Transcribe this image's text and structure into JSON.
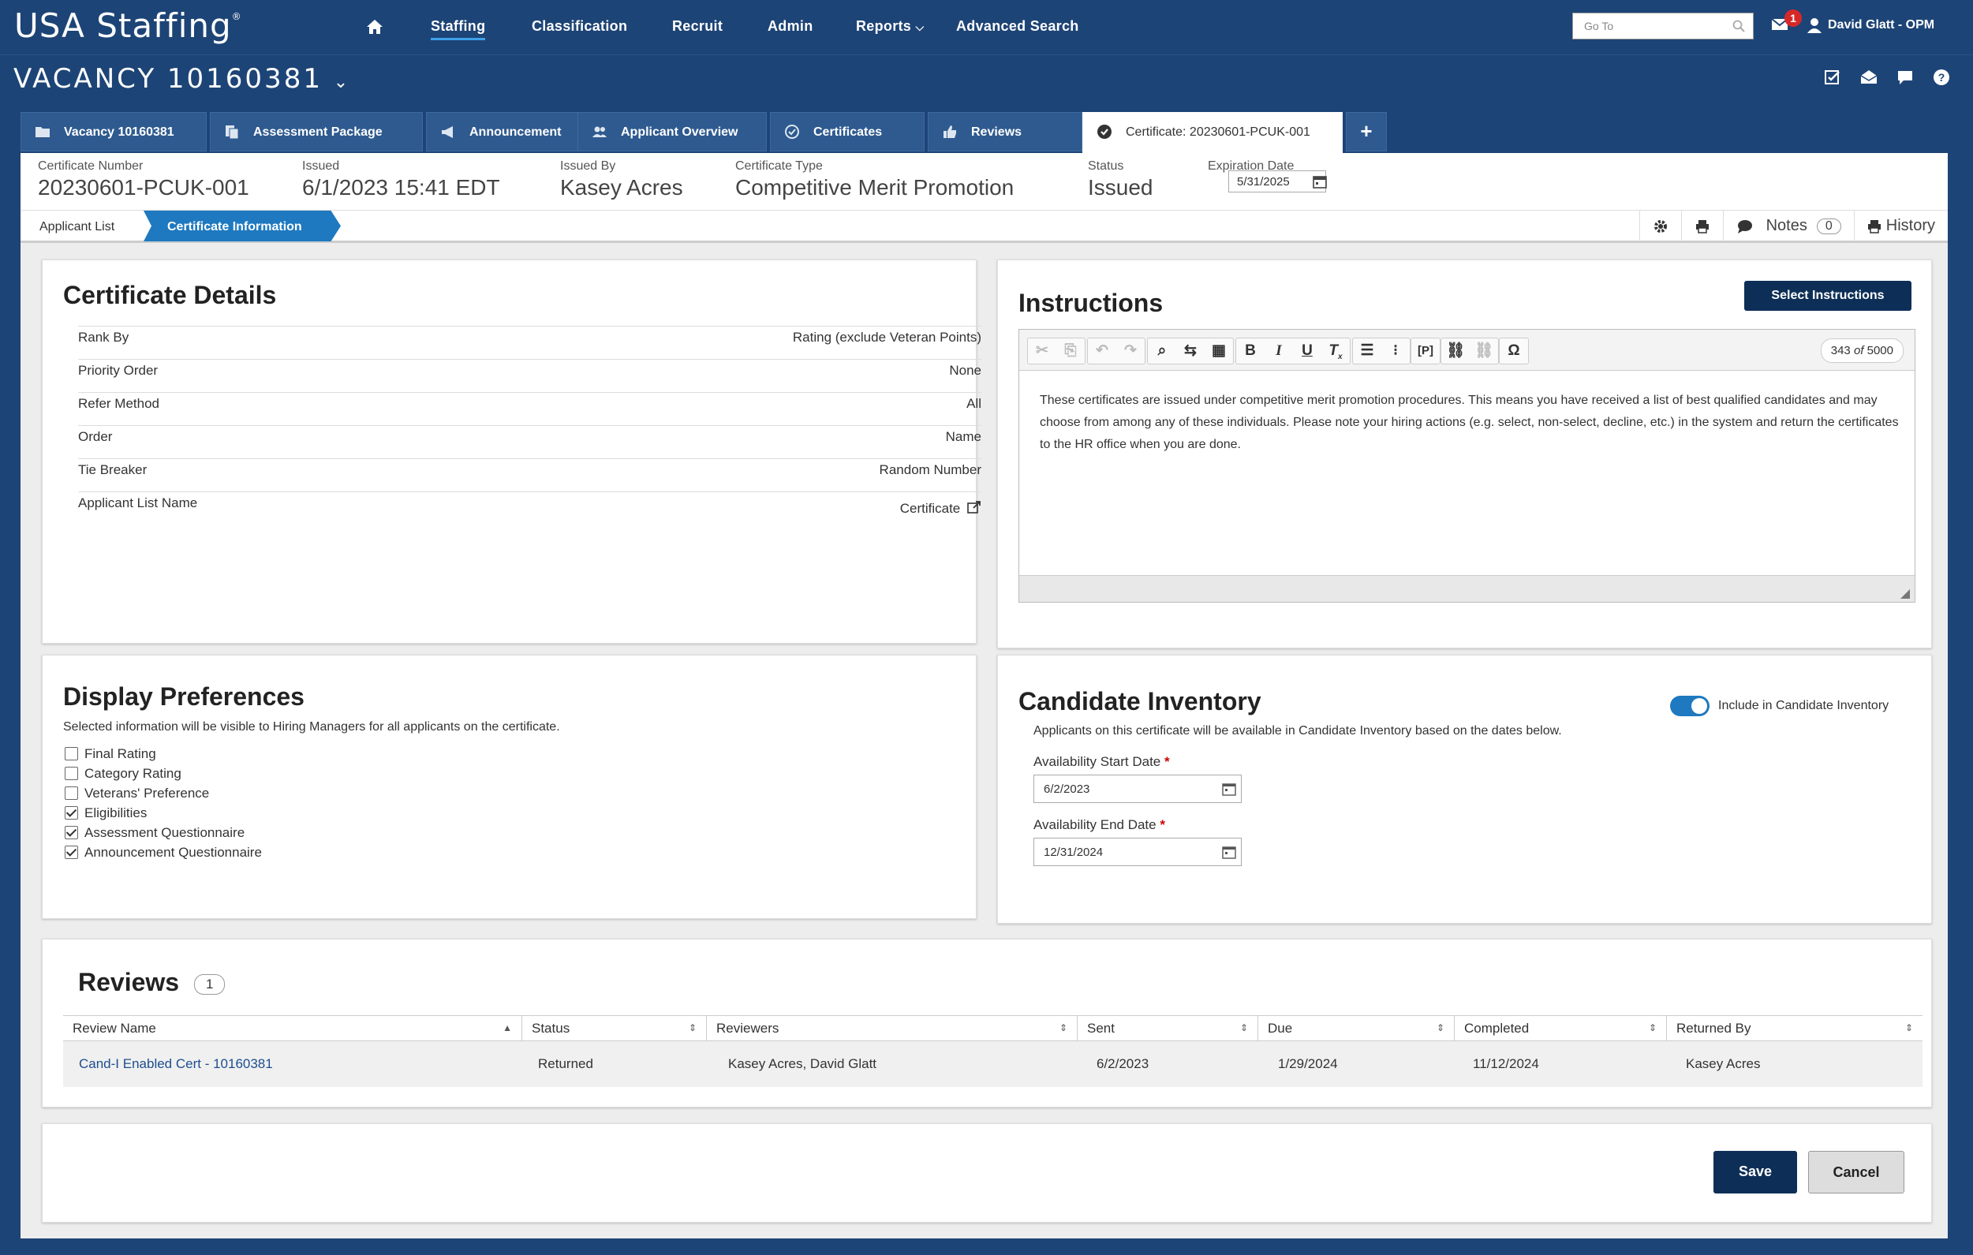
{
  "app": {
    "logo": "USA Staffing",
    "logo_mark": "®"
  },
  "nav": {
    "items": [
      "Staffing",
      "Classification",
      "Recruit",
      "Admin",
      "Reports",
      "Advanced Search"
    ],
    "goto_placeholder": "Go To",
    "mail_count": "1",
    "user": "David Glatt - OPM"
  },
  "vacancy": {
    "title": "VACANCY 10160381"
  },
  "tabs": [
    "Vacancy 10160381",
    "Assessment Package",
    "Announcement",
    "Applicant Overview",
    "Certificates",
    "Reviews",
    "Certificate: 20230601-PCUK-001",
    "+"
  ],
  "cert": {
    "number_label": "Certificate Number",
    "number": "20230601-PCUK-001",
    "issued_label": "Issued",
    "issued": "6/1/2023 15:41 EDT",
    "issued_by_label": "Issued By",
    "issued_by": "Kasey Acres",
    "type_label": "Certificate Type",
    "type": "Competitive Merit Promotion",
    "status_label": "Status",
    "status": "Issued",
    "expiration_label": "Expiration Date",
    "expiration": "5/31/2025"
  },
  "subnav": {
    "crumb1": "Applicant List",
    "crumb2": "Certificate Information",
    "notes": "Notes",
    "notes_count": "0",
    "history": "History"
  },
  "details": {
    "title": "Certificate Details",
    "rows": [
      {
        "k": "Rank By",
        "v": "Rating (exclude Veteran Points)"
      },
      {
        "k": "Priority Order",
        "v": "None"
      },
      {
        "k": "Refer Method",
        "v": "All"
      },
      {
        "k": "Order",
        "v": "Name"
      },
      {
        "k": "Tie Breaker",
        "v": "Random Number"
      },
      {
        "k": "Applicant List Name",
        "v": "Certificate"
      }
    ]
  },
  "instructions": {
    "title": "Instructions",
    "select_button": "Select Instructions",
    "count": "343",
    "count_of": "of",
    "count_max": "5000",
    "body": "These certificates are issued under competitive merit promotion procedures. This means you have received a list of best qualified candidates and may choose from among any of these individuals. Please note your hiring actions (e.g. select, non-select, decline, etc.) in the system and return the certificates to the HR office when you are done."
  },
  "display": {
    "title": "Display Preferences",
    "desc": "Selected information will be visible to Hiring Managers for all applicants on the certificate.",
    "options": [
      {
        "label": "Final Rating",
        "checked": false
      },
      {
        "label": "Category Rating",
        "checked": false
      },
      {
        "label": "Veterans' Preference",
        "checked": false
      },
      {
        "label": "Eligibilities",
        "checked": true
      },
      {
        "label": "Assessment Questionnaire",
        "checked": true
      },
      {
        "label": "Announcement Questionnaire",
        "checked": true
      }
    ]
  },
  "inventory": {
    "title": "Candidate Inventory",
    "toggle_label": "Include in Candidate Inventory",
    "toggle_on": true,
    "desc": "Applicants on this certificate will be available in Candidate Inventory based on the dates below.",
    "start_label": "Availability Start Date",
    "start": "6/2/2023",
    "end_label": "Availability End Date",
    "end": "12/31/2024",
    "required_mark": "*"
  },
  "reviews": {
    "title": "Reviews",
    "count": "1",
    "columns": [
      "Review Name",
      "Status",
      "Reviewers",
      "Sent",
      "Due",
      "Completed",
      "Returned By"
    ],
    "rows": [
      [
        "Cand-I Enabled Cert - 10160381",
        "Returned",
        "Kasey Acres, David Glatt",
        "6/2/2023",
        "1/29/2024",
        "11/12/2024",
        "Kasey Acres"
      ]
    ]
  },
  "actions": {
    "save": "Save",
    "cancel": "Cancel"
  },
  "colors": {
    "navy": "#1d4476",
    "accent": "#1e79c0",
    "button_dark": "#0d2f57"
  }
}
